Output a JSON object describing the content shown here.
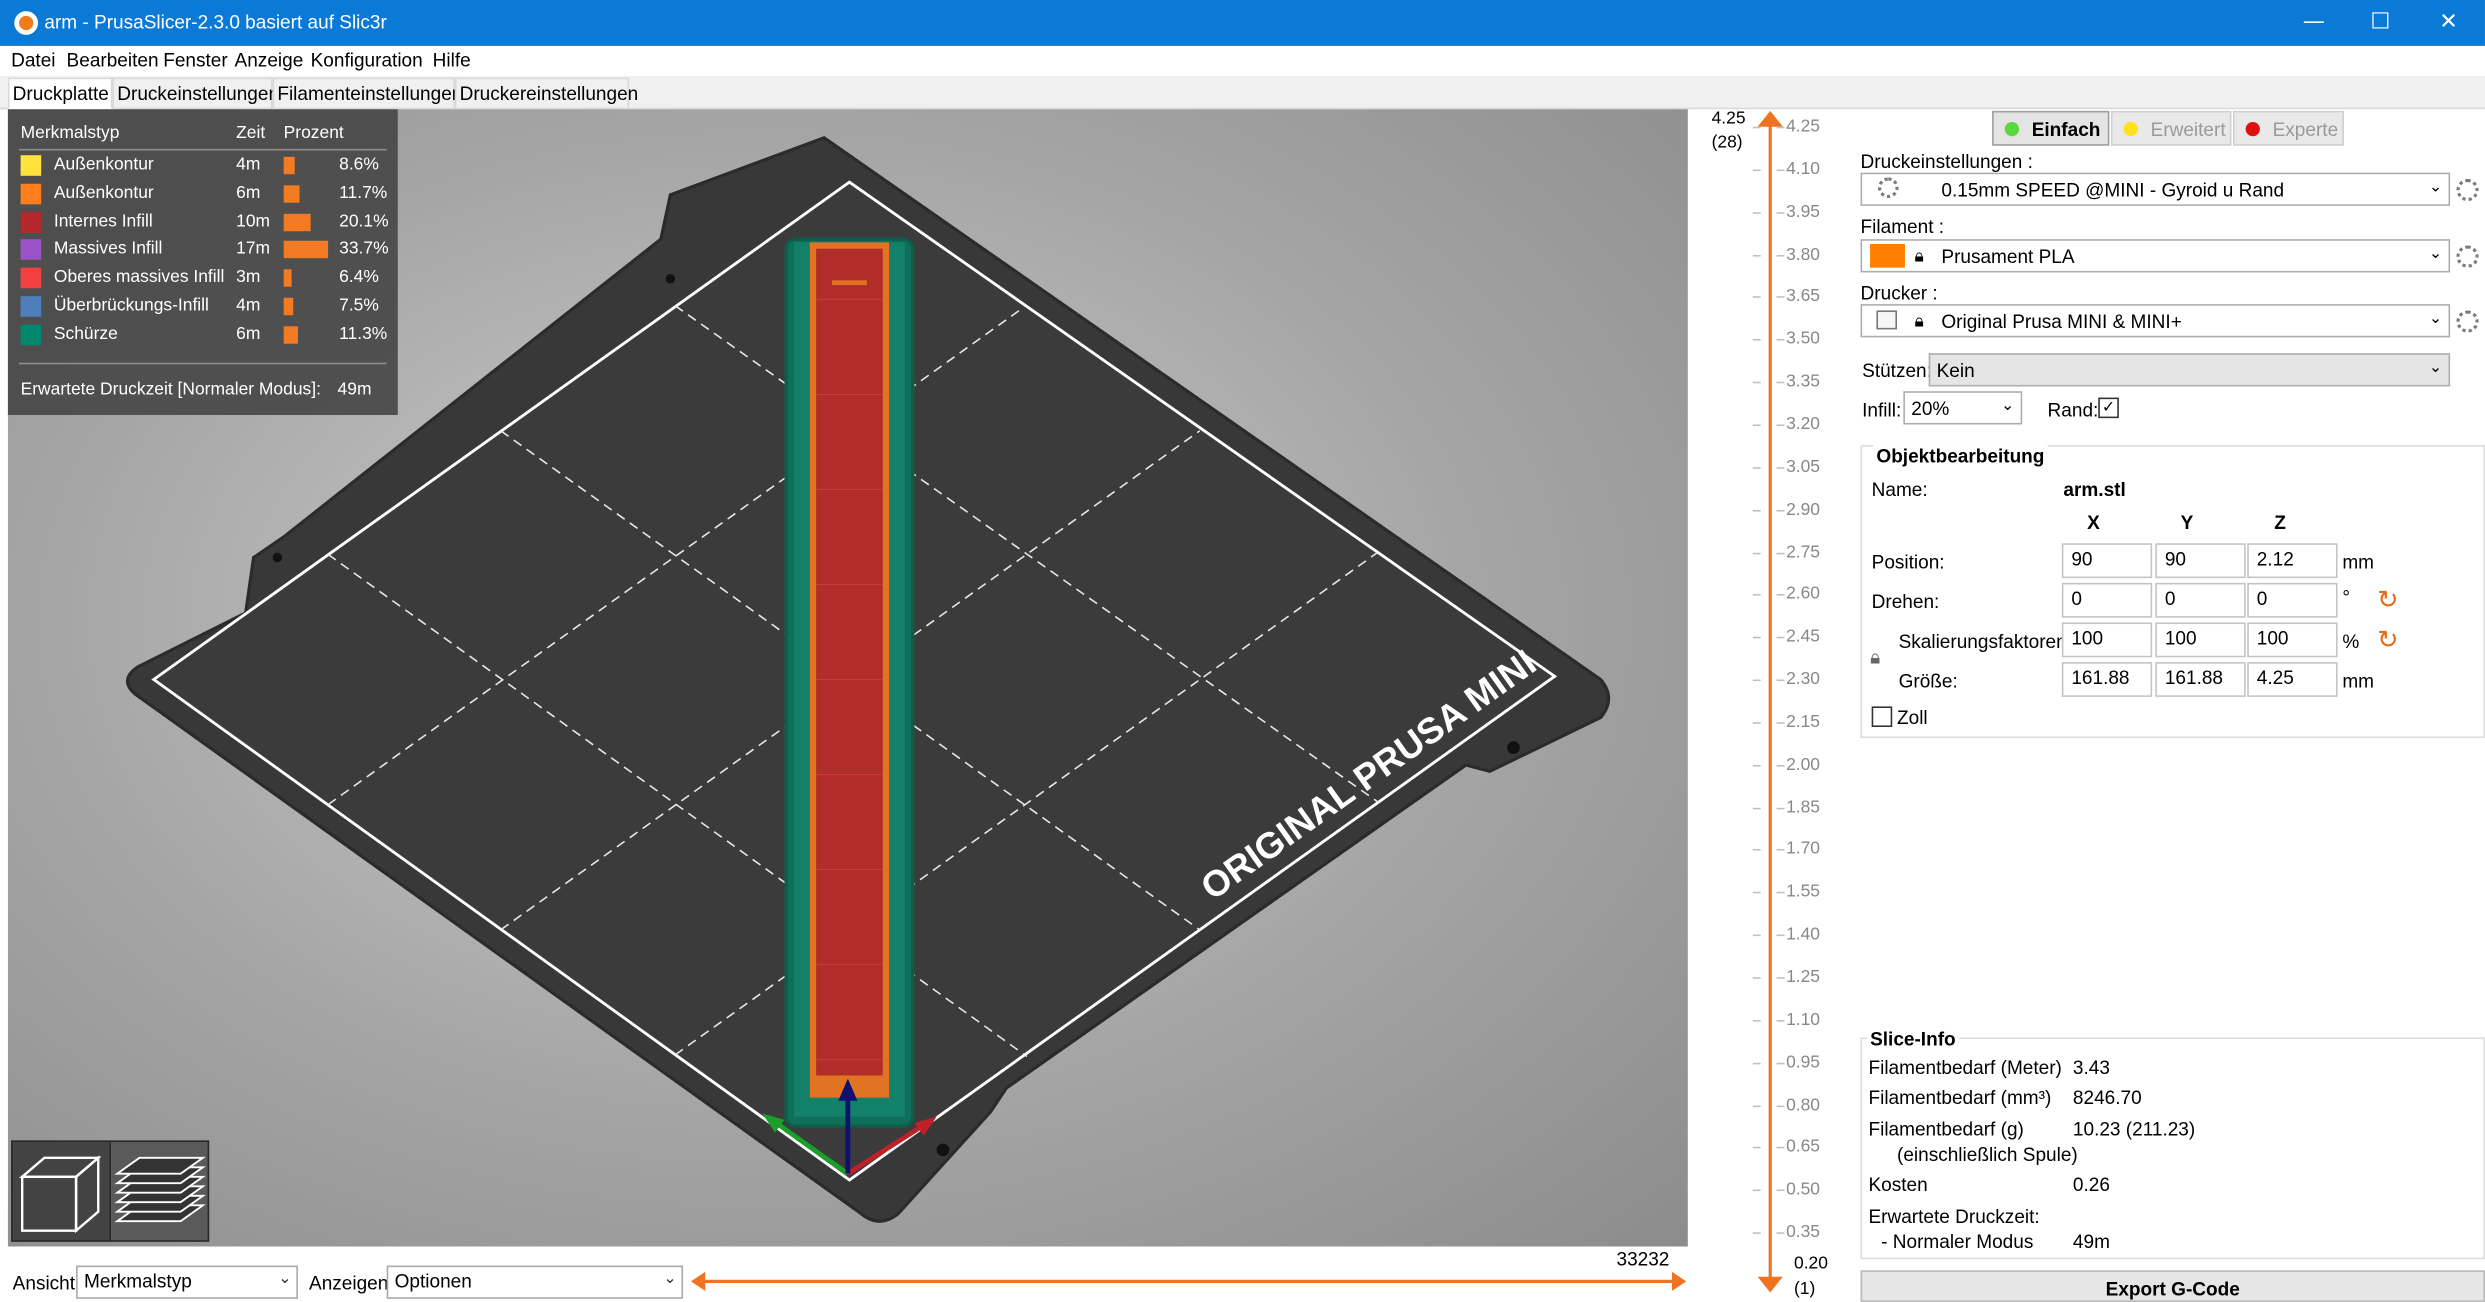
{
  "window": {
    "title": "arm - PrusaSlicer-2.3.0 basiert auf Slic3r",
    "minimize": "—",
    "maximize": "☐",
    "close": "✕"
  },
  "menu": [
    "Datei",
    "Bearbeiten",
    "Fenster",
    "Anzeige",
    "Konfiguration",
    "Hilfe"
  ],
  "tabs": [
    "Druckplatte",
    "Druckeinstellungen",
    "Filamenteinstellungen",
    "Druckereinstellungen"
  ],
  "legend": {
    "headers": [
      "Merkmalstyp",
      "Zeit",
      "Prozent"
    ],
    "rows": [
      {
        "name": "Außenkontur",
        "time": "4m",
        "percent": "8.6%",
        "value": 8.6,
        "color": "#ffe23b"
      },
      {
        "name": "Außenkontur",
        "time": "6m",
        "percent": "11.7%",
        "value": 11.7,
        "color": "#ff7d1a"
      },
      {
        "name": "Internes Infill",
        "time": "10m",
        "percent": "20.1%",
        "value": 20.1,
        "color": "#b3282a"
      },
      {
        "name": "Massives Infill",
        "time": "17m",
        "percent": "33.7%",
        "value": 33.7,
        "color": "#9b52c6"
      },
      {
        "name": "Oberes massives Infill",
        "time": "3m",
        "percent": "6.4%",
        "value": 6.4,
        "color": "#f04040"
      },
      {
        "name": "Überbrückungs-Infill",
        "time": "4m",
        "percent": "7.5%",
        "value": 7.5,
        "color": "#4d80ba"
      },
      {
        "name": "Schürze",
        "time": "6m",
        "percent": "11.3%",
        "value": 11.3,
        "color": "#00876e"
      }
    ],
    "estimated_label": "Erwartete Druckzeit [Normaler Modus]:",
    "estimated_value": "49m"
  },
  "bed": {
    "label": "ORIGINAL PRUSA MINI"
  },
  "bottom": {
    "view_label": "Ansicht",
    "view_value": "Merkmalstyp",
    "show_label": "Anzeigen",
    "show_value": "Optionen",
    "move_count": "33232"
  },
  "layer_slider": {
    "top_value": "4.25",
    "top_layer": "(28)",
    "bottom_value": "0.20",
    "bottom_layer": "(1)",
    "ticks": [
      "4.25",
      "4.10",
      "3.95",
      "3.80",
      "3.65",
      "3.50",
      "3.35",
      "3.20",
      "3.05",
      "2.90",
      "2.75",
      "2.60",
      "2.45",
      "2.30",
      "2.15",
      "2.00",
      "1.85",
      "1.70",
      "1.55",
      "1.40",
      "1.25",
      "1.10",
      "0.95",
      "0.80",
      "0.65",
      "0.50",
      "0.35"
    ]
  },
  "modes": {
    "simple": "Einfach",
    "simple_color": "#5cd63d",
    "advanced": "Erweitert",
    "advanced_color": "#ffe219",
    "expert": "Experte",
    "expert_color": "#e01010"
  },
  "presets": {
    "print_label": "Druckeinstellungen :",
    "print_value": "0.15mm SPEED @MINI - Gyroid u Rand",
    "filament_label": "Filament :",
    "filament_value": "Prusament PLA",
    "filament_color": "#ff8000",
    "printer_label": "Drucker :",
    "printer_value": "Original Prusa MINI & MINI+",
    "support_label": "Stützen:",
    "support_value": "Kein",
    "infill_label": "Infill:",
    "infill_value": "20%",
    "brim_label": "Rand:",
    "brim_checked": "✓"
  },
  "object": {
    "section_title": "Objektbearbeitung",
    "name_label": "Name:",
    "name_value": "arm.stl",
    "col_x": "X",
    "col_y": "Y",
    "col_z": "Z",
    "position_label": "Position:",
    "position": [
      "90",
      "90",
      "2.12"
    ],
    "position_unit": "mm",
    "rotation_label": "Drehen:",
    "rotation": [
      "0",
      "0",
      "0"
    ],
    "rotation_unit": "°",
    "scale_label": "Skalierungsfaktoren:",
    "scale": [
      "100",
      "100",
      "100"
    ],
    "scale_unit": "%",
    "size_label": "Größe:",
    "size": [
      "161.88",
      "161.88",
      "4.25"
    ],
    "size_unit": "mm",
    "inches_label": "Zoll"
  },
  "slice_info": {
    "title": "Slice-Info",
    "rows": [
      {
        "label": "Filamentbedarf (Meter)",
        "value": "3.43"
      },
      {
        "label": "Filamentbedarf (mm³)",
        "value": "8246.70"
      },
      {
        "label": "Filamentbedarf (g)",
        "value": "10.23 (211.23)"
      },
      {
        "label": "(einschließlich Spule)",
        "value": ""
      },
      {
        "label": "Kosten",
        "value": "0.26"
      },
      {
        "label": "Erwartete Druckzeit:",
        "value": ""
      },
      {
        "label": "- Normaler Modus",
        "value": "49m"
      }
    ],
    "export_label": "Export G-Code"
  }
}
